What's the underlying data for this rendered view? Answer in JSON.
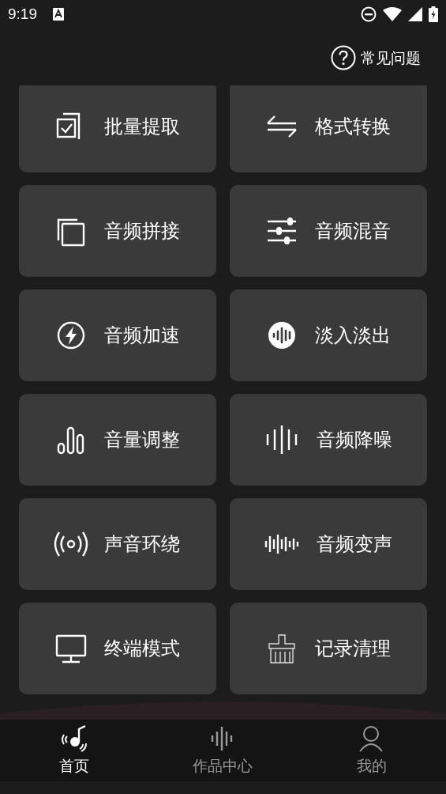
{
  "status_bar": {
    "time": "9:19"
  },
  "header": {
    "help_link": "常见问题"
  },
  "tools": [
    {
      "label": "批量提取"
    },
    {
      "label": "格式转换"
    },
    {
      "label": "音频拼接"
    },
    {
      "label": "音频混音"
    },
    {
      "label": "音频加速"
    },
    {
      "label": "淡入淡出"
    },
    {
      "label": "音量调整"
    },
    {
      "label": "音频降噪"
    },
    {
      "label": "声音环绕"
    },
    {
      "label": "音频变声"
    },
    {
      "label": "终端模式"
    },
    {
      "label": "记录清理"
    }
  ],
  "bottom_nav": [
    {
      "label": "首页",
      "selected": true
    },
    {
      "label": "作品中心",
      "selected": false
    },
    {
      "label": "我的",
      "selected": false
    }
  ]
}
